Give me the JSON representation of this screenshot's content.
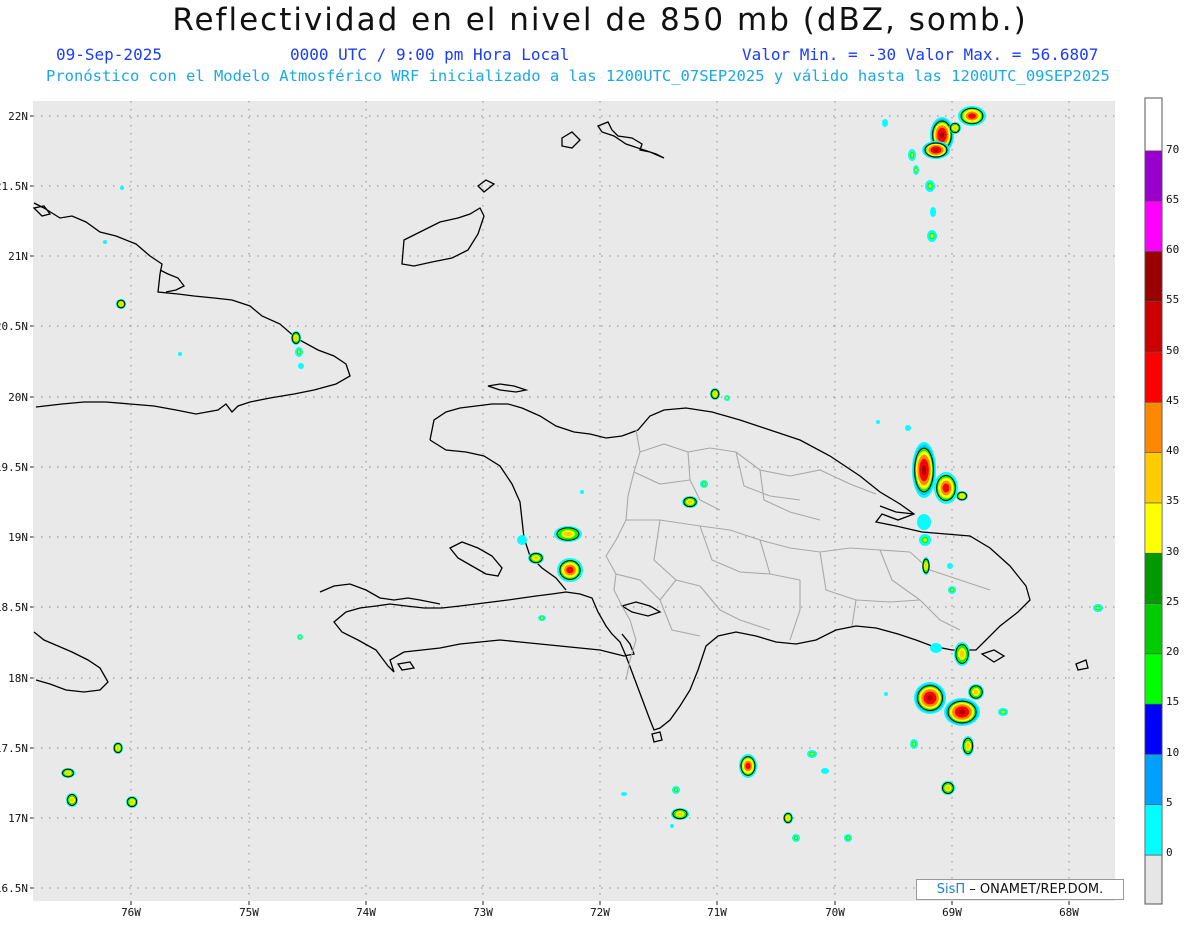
{
  "title": "Reflectividad en el nivel de 850 mb (dBZ, somb.)",
  "date": "09-Sep-2025",
  "time": "0000 UTC / 9:00 pm Hora Local",
  "valrange": "Valor Min. = -30  Valor Max. = 56.6807",
  "forecast": "Pronóstico con el Modelo Atmosférico WRF inicializado a las 1200UTC_07SEP2025 y válido hasta las  1200UTC_09SEP2025",
  "lat_labels": [
    "22N",
    "21.5N",
    "21N",
    "20.5N",
    "20N",
    "19.5N",
    "19N",
    "18.5N",
    "18N",
    "17.5N",
    "17N",
    "16.5N"
  ],
  "lon_labels": [
    "76W",
    "75W",
    "74W",
    "73W",
    "72W",
    "71W",
    "70W",
    "69W",
    "68W"
  ],
  "legend": {
    "labels": [
      "0",
      "5",
      "10",
      "15",
      "20",
      "25",
      "30",
      "35",
      "40",
      "45",
      "50",
      "55",
      "60",
      "65",
      "70"
    ],
    "colors": [
      "#00ffff",
      "#00a0ff",
      "#0000ff",
      "#00ff00",
      "#00cc00",
      "#009900",
      "#ffff00",
      "#ffcc00",
      "#ff8800",
      "#ff0000",
      "#cc0000",
      "#990000",
      "#ff00ff",
      "#9900cc"
    ]
  },
  "credit": {
    "brand": "SisΠ",
    "text": " – ONAMET/REP.DOM."
  }
}
